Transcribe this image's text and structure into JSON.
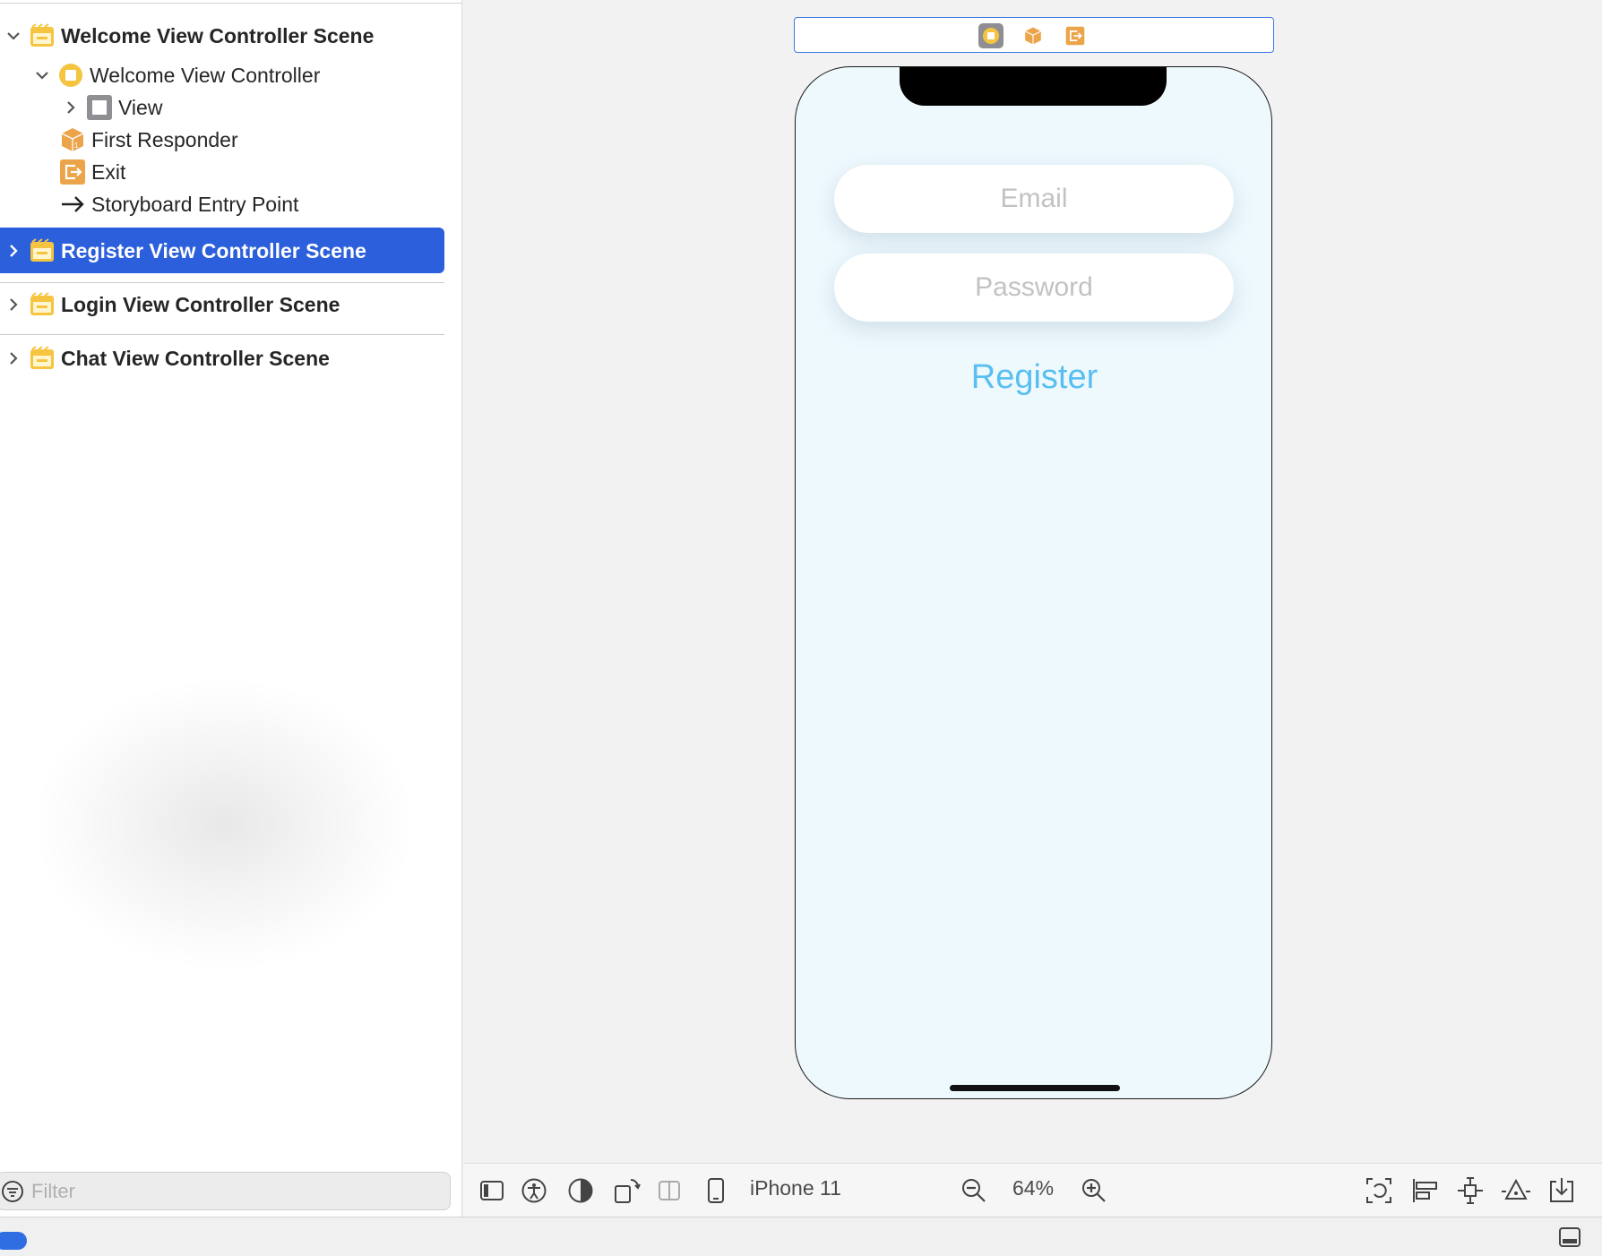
{
  "outline": {
    "items": [
      {
        "label": "Welcome View Controller Scene",
        "icon": "storyboard-scene-icon",
        "expanded": true
      },
      {
        "label": "Welcome View Controller",
        "icon": "view-controller-icon",
        "expanded": true
      },
      {
        "label": "View",
        "icon": "view-icon",
        "expanded": false
      },
      {
        "label": "First Responder",
        "icon": "first-responder-icon"
      },
      {
        "label": "Exit",
        "icon": "exit-icon"
      },
      {
        "label": "Storyboard Entry Point",
        "icon": "arrow-right-icon"
      },
      {
        "label": "Register View Controller Scene",
        "icon": "storyboard-scene-icon",
        "expanded": false,
        "selected": true
      },
      {
        "label": "Login View Controller Scene",
        "icon": "storyboard-scene-icon",
        "expanded": false
      },
      {
        "label": "Chat View Controller Scene",
        "icon": "storyboard-scene-icon",
        "expanded": false
      }
    ],
    "filter_placeholder": "Filter"
  },
  "canvas": {
    "scene_bar_icons": [
      "view-controller-icon",
      "first-responder-icon",
      "exit-icon"
    ],
    "device_screen": {
      "email_placeholder": "Email",
      "password_placeholder": "Password",
      "register_label": "Register",
      "background": "#eef9fe",
      "accent": "#58bff0"
    }
  },
  "toolbar": {
    "device": "iPhone 11",
    "zoom": "64%"
  },
  "colors": {
    "selection": "#2c5fdb",
    "scene_icon": "#f5c542",
    "exit_icon": "#eba44a"
  }
}
